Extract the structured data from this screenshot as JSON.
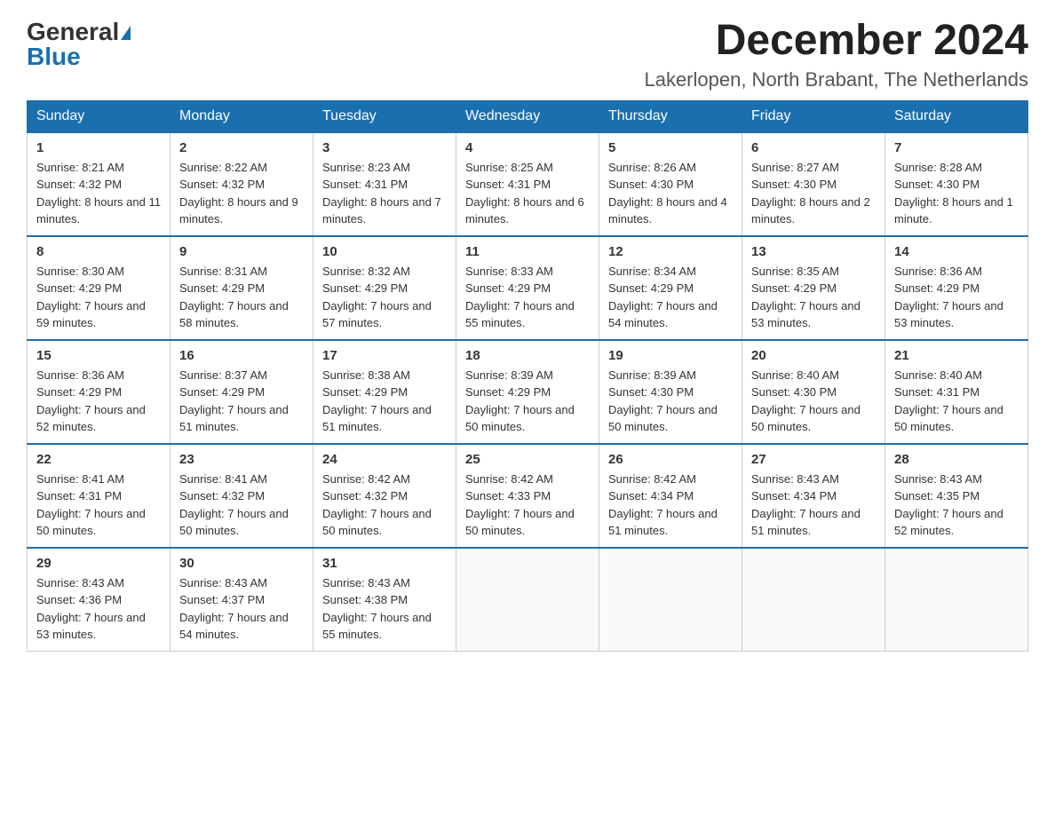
{
  "header": {
    "logo_general": "General",
    "logo_blue": "Blue",
    "month_title": "December 2024",
    "location": "Lakerlopen, North Brabant, The Netherlands"
  },
  "days_of_week": [
    "Sunday",
    "Monday",
    "Tuesday",
    "Wednesday",
    "Thursday",
    "Friday",
    "Saturday"
  ],
  "weeks": [
    [
      {
        "day": "1",
        "sunrise": "8:21 AM",
        "sunset": "4:32 PM",
        "daylight": "8 hours and 11 minutes."
      },
      {
        "day": "2",
        "sunrise": "8:22 AM",
        "sunset": "4:32 PM",
        "daylight": "8 hours and 9 minutes."
      },
      {
        "day": "3",
        "sunrise": "8:23 AM",
        "sunset": "4:31 PM",
        "daylight": "8 hours and 7 minutes."
      },
      {
        "day": "4",
        "sunrise": "8:25 AM",
        "sunset": "4:31 PM",
        "daylight": "8 hours and 6 minutes."
      },
      {
        "day": "5",
        "sunrise": "8:26 AM",
        "sunset": "4:30 PM",
        "daylight": "8 hours and 4 minutes."
      },
      {
        "day": "6",
        "sunrise": "8:27 AM",
        "sunset": "4:30 PM",
        "daylight": "8 hours and 2 minutes."
      },
      {
        "day": "7",
        "sunrise": "8:28 AM",
        "sunset": "4:30 PM",
        "daylight": "8 hours and 1 minute."
      }
    ],
    [
      {
        "day": "8",
        "sunrise": "8:30 AM",
        "sunset": "4:29 PM",
        "daylight": "7 hours and 59 minutes."
      },
      {
        "day": "9",
        "sunrise": "8:31 AM",
        "sunset": "4:29 PM",
        "daylight": "7 hours and 58 minutes."
      },
      {
        "day": "10",
        "sunrise": "8:32 AM",
        "sunset": "4:29 PM",
        "daylight": "7 hours and 57 minutes."
      },
      {
        "day": "11",
        "sunrise": "8:33 AM",
        "sunset": "4:29 PM",
        "daylight": "7 hours and 55 minutes."
      },
      {
        "day": "12",
        "sunrise": "8:34 AM",
        "sunset": "4:29 PM",
        "daylight": "7 hours and 54 minutes."
      },
      {
        "day": "13",
        "sunrise": "8:35 AM",
        "sunset": "4:29 PM",
        "daylight": "7 hours and 53 minutes."
      },
      {
        "day": "14",
        "sunrise": "8:36 AM",
        "sunset": "4:29 PM",
        "daylight": "7 hours and 53 minutes."
      }
    ],
    [
      {
        "day": "15",
        "sunrise": "8:36 AM",
        "sunset": "4:29 PM",
        "daylight": "7 hours and 52 minutes."
      },
      {
        "day": "16",
        "sunrise": "8:37 AM",
        "sunset": "4:29 PM",
        "daylight": "7 hours and 51 minutes."
      },
      {
        "day": "17",
        "sunrise": "8:38 AM",
        "sunset": "4:29 PM",
        "daylight": "7 hours and 51 minutes."
      },
      {
        "day": "18",
        "sunrise": "8:39 AM",
        "sunset": "4:29 PM",
        "daylight": "7 hours and 50 minutes."
      },
      {
        "day": "19",
        "sunrise": "8:39 AM",
        "sunset": "4:30 PM",
        "daylight": "7 hours and 50 minutes."
      },
      {
        "day": "20",
        "sunrise": "8:40 AM",
        "sunset": "4:30 PM",
        "daylight": "7 hours and 50 minutes."
      },
      {
        "day": "21",
        "sunrise": "8:40 AM",
        "sunset": "4:31 PM",
        "daylight": "7 hours and 50 minutes."
      }
    ],
    [
      {
        "day": "22",
        "sunrise": "8:41 AM",
        "sunset": "4:31 PM",
        "daylight": "7 hours and 50 minutes."
      },
      {
        "day": "23",
        "sunrise": "8:41 AM",
        "sunset": "4:32 PM",
        "daylight": "7 hours and 50 minutes."
      },
      {
        "day": "24",
        "sunrise": "8:42 AM",
        "sunset": "4:32 PM",
        "daylight": "7 hours and 50 minutes."
      },
      {
        "day": "25",
        "sunrise": "8:42 AM",
        "sunset": "4:33 PM",
        "daylight": "7 hours and 50 minutes."
      },
      {
        "day": "26",
        "sunrise": "8:42 AM",
        "sunset": "4:34 PM",
        "daylight": "7 hours and 51 minutes."
      },
      {
        "day": "27",
        "sunrise": "8:43 AM",
        "sunset": "4:34 PM",
        "daylight": "7 hours and 51 minutes."
      },
      {
        "day": "28",
        "sunrise": "8:43 AM",
        "sunset": "4:35 PM",
        "daylight": "7 hours and 52 minutes."
      }
    ],
    [
      {
        "day": "29",
        "sunrise": "8:43 AM",
        "sunset": "4:36 PM",
        "daylight": "7 hours and 53 minutes."
      },
      {
        "day": "30",
        "sunrise": "8:43 AM",
        "sunset": "4:37 PM",
        "daylight": "7 hours and 54 minutes."
      },
      {
        "day": "31",
        "sunrise": "8:43 AM",
        "sunset": "4:38 PM",
        "daylight": "7 hours and 55 minutes."
      },
      null,
      null,
      null,
      null
    ]
  ]
}
